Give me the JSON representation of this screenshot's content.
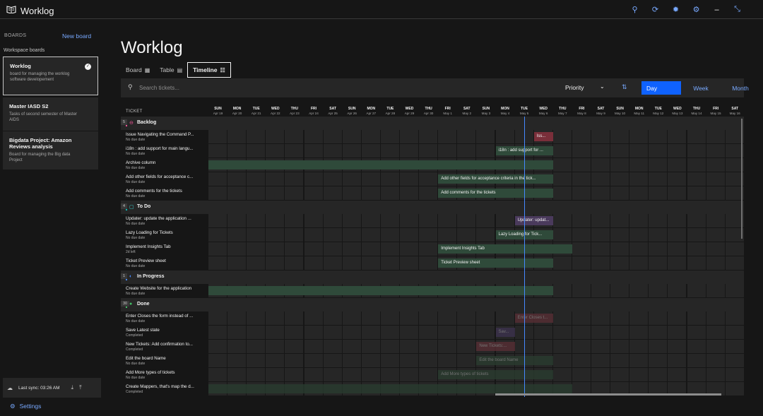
{
  "app": {
    "name": "Worklog",
    "logo": "book-logo-icon"
  },
  "top_actions": [
    "search-icon",
    "refresh-icon",
    "brightness-icon",
    "settings-icon",
    "minimize-icon",
    "collapse-icon"
  ],
  "sidebar": {
    "boards_label": "BOARDS",
    "new_board": "New board",
    "workspace_label": "Workspace boards",
    "boards": [
      {
        "title": "Worklog",
        "desc": "board for managing the worklog software developement",
        "active": true
      },
      {
        "title": "Master IASD S2",
        "desc": "Tasks of second semester of Master AIDS",
        "active": false
      },
      {
        "title": "Bigdata Project: Amazon Reviews analysis",
        "desc": "Board for managing the Big data Project",
        "active": false
      }
    ],
    "sync": "Last sync: 03:26 AM",
    "settings": "Settings"
  },
  "page": {
    "title": "Worklog",
    "tabs": [
      {
        "label": "Board",
        "icon": "board-icon",
        "active": false
      },
      {
        "label": "Table",
        "icon": "table-icon",
        "active": false
      },
      {
        "label": "Timeline",
        "icon": "timeline-icon",
        "active": true
      }
    ],
    "search_placeholder": "Search tickets...",
    "sort_label": "Priority",
    "views": [
      "Day",
      "Week",
      "Month"
    ],
    "active_view": "Day"
  },
  "timeline": {
    "ticket_header": "TICKET",
    "days": [
      {
        "name": "SUN",
        "date": "Apr 19"
      },
      {
        "name": "MON",
        "date": "Apr 20"
      },
      {
        "name": "TUE",
        "date": "Apr 21"
      },
      {
        "name": "WED",
        "date": "Apr 22"
      },
      {
        "name": "THU",
        "date": "Apr 23"
      },
      {
        "name": "FRI",
        "date": "Apr 24"
      },
      {
        "name": "SAT",
        "date": "Apr 25"
      },
      {
        "name": "SUN",
        "date": "Apr 26"
      },
      {
        "name": "MON",
        "date": "Apr 27"
      },
      {
        "name": "TUE",
        "date": "Apr 28"
      },
      {
        "name": "WED",
        "date": "Apr 29"
      },
      {
        "name": "THU",
        "date": "Apr 30"
      },
      {
        "name": "FRI",
        "date": "May 1"
      },
      {
        "name": "SAT",
        "date": "May 2"
      },
      {
        "name": "SUN",
        "date": "May 3"
      },
      {
        "name": "MON",
        "date": "May 4"
      },
      {
        "name": "TUE",
        "date": "May 5"
      },
      {
        "name": "WED",
        "date": "May 6"
      },
      {
        "name": "THU",
        "date": "May 7"
      },
      {
        "name": "FRI",
        "date": "May 8"
      },
      {
        "name": "SAT",
        "date": "May 9"
      },
      {
        "name": "SUN",
        "date": "May 10"
      },
      {
        "name": "MON",
        "date": "May 11"
      },
      {
        "name": "TUE",
        "date": "May 12"
      },
      {
        "name": "WED",
        "date": "May 13"
      },
      {
        "name": "THU",
        "date": "May 14"
      },
      {
        "name": "FRI",
        "date": "May 15"
      },
      {
        "name": "SAT",
        "date": "May 16"
      }
    ],
    "groups": [
      {
        "name": "Backlog",
        "count": "5",
        "color": "#ee5396",
        "icon": "⊖",
        "icon_color": "#ee5396",
        "tickets": [
          {
            "title": "Issue Navigating the Command P...",
            "due": "No due date",
            "bar": "Iss...",
            "start": 17,
            "span": 1,
            "color": "#7a2f3a",
            "fade": false
          },
          {
            "title": "i18n : add support for main langu...",
            "due": "No due date",
            "bar": "i18n : add support for ...",
            "start": 15,
            "span": 3,
            "color": "#2f4a3a",
            "fade": false
          },
          {
            "title": "Archive column",
            "due": "No due date",
            "bar": "",
            "start": 0,
            "span": 18,
            "color": "#2f4a3a",
            "fade": false
          },
          {
            "title": "Add other fields for acceptance c...",
            "due": "No due date",
            "bar": "Add other fields for acceptance criteria in the tick...",
            "start": 12,
            "span": 6,
            "color": "#2f4a3a",
            "fade": false
          },
          {
            "title": "Add comments for the tickets",
            "due": "No due date",
            "bar": "Add comments for the tickets",
            "start": 12,
            "span": 6,
            "color": "#2f4a3a",
            "fade": false
          }
        ]
      },
      {
        "name": "To Do",
        "count": "4",
        "color": "#08bdba",
        "icon": "▢",
        "icon_color": "#3ddbd9",
        "tickets": [
          {
            "title": "Updater: update the application ...",
            "due": "No due date",
            "bar": "Updater: updat...",
            "start": 16,
            "span": 2,
            "color": "#4a3a5c",
            "fade": false
          },
          {
            "title": "Lazy Loading for Tickets",
            "due": "No due date",
            "bar": "Lazy Loading for Tick...",
            "start": 15,
            "span": 3,
            "color": "#2f4a3a",
            "fade": false
          },
          {
            "title": "Implement Insights Tab",
            "due": "2d left",
            "bar": "Implement Insights Tab",
            "start": 12,
            "span": 7,
            "color": "#2f4a3a",
            "fade": false
          },
          {
            "title": "Ticket Preview sheet",
            "due": "No due date",
            "bar": "Ticket Preview sheet",
            "start": 12,
            "span": 6,
            "color": "#2f4a3a",
            "fade": false
          }
        ]
      },
      {
        "name": "In Progress",
        "count": "1",
        "color": "#4589ff",
        "icon": "◐",
        "icon_color": "#4589ff",
        "tickets": [
          {
            "title": "Create Website for the application",
            "due": "No due date",
            "bar": "",
            "start": 0,
            "span": 18,
            "color": "#2f4a3a",
            "fade": false
          }
        ]
      },
      {
        "name": "Done",
        "count": "30",
        "color": "#42be65",
        "icon": "●",
        "icon_color": "#42be65",
        "tickets": [
          {
            "title": "Enter Closes the form instead of ...",
            "due": "No due date",
            "bar": "Enter Closes t...",
            "start": 16,
            "span": 2,
            "color": "#5a2f35",
            "fade": true
          },
          {
            "title": "Save Latest state",
            "due": "Completed",
            "bar": "Sav...",
            "start": 15,
            "span": 1,
            "color": "#3d3350",
            "fade": true
          },
          {
            "title": "New Tickets: Add confirmation to...",
            "due": "Completed",
            "bar": "New Tickets:...",
            "start": 14,
            "span": 2,
            "color": "#5a2f35",
            "fade": true
          },
          {
            "title": "Edit the board Name",
            "due": "No due date",
            "bar": "Edit the board Name",
            "start": 14,
            "span": 4,
            "color": "#2a3d30",
            "fade": true
          },
          {
            "title": "Add More types of tickets",
            "due": "No due date",
            "bar": "Add More types of tickets",
            "start": 12,
            "span": 6,
            "color": "#2a3d30",
            "fade": true
          },
          {
            "title": "Create Mappers, that's map the d...",
            "due": "Completed",
            "bar": "",
            "start": 0,
            "span": 19,
            "color": "#2a3d30",
            "fade": true
          }
        ]
      }
    ]
  }
}
